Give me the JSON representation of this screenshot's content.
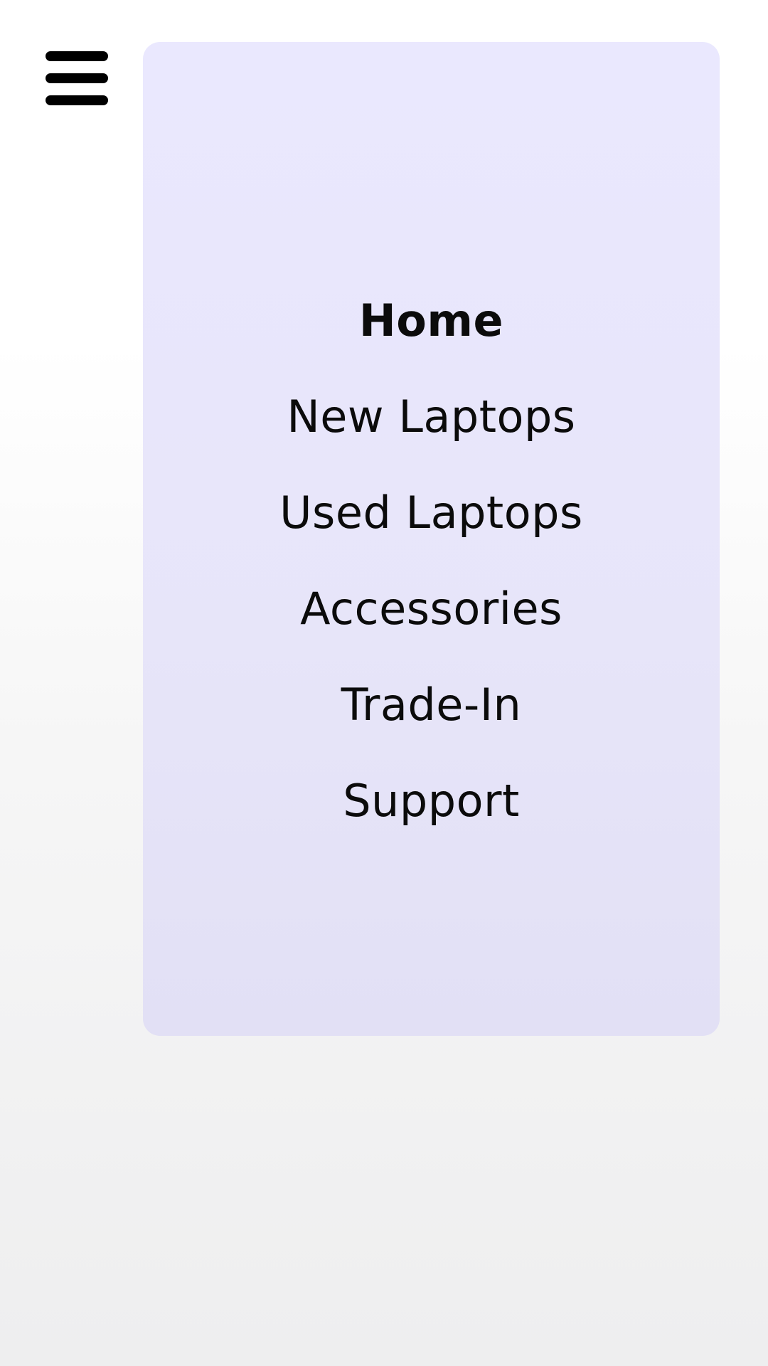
{
  "header": {
    "menu_icon": "hamburger-menu-icon"
  },
  "menu": {
    "active_index": 0,
    "items": [
      {
        "label": "Home"
      },
      {
        "label": "New Laptops"
      },
      {
        "label": "Used Laptops"
      },
      {
        "label": "Accessories"
      },
      {
        "label": "Trade-In"
      },
      {
        "label": "Support"
      }
    ]
  },
  "colors": {
    "panel_background": "#eae8fe",
    "text": "#0b0b0b",
    "icon": "#000000"
  }
}
